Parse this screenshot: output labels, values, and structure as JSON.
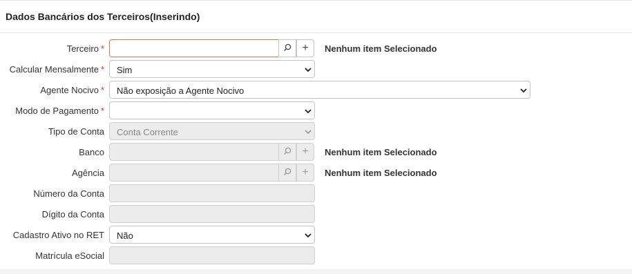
{
  "panel": {
    "title": "Dados Bancários dos Terceiros(Inserindo)"
  },
  "form": {
    "terceiro": {
      "label": "Terceiro",
      "required": "*",
      "value": "",
      "selection": "Nenhum item Selecionado"
    },
    "calcular": {
      "label": "Calcular Mensalmente",
      "required": "*",
      "value": "Sim"
    },
    "agente": {
      "label": "Agente Nocivo",
      "required": "*",
      "value": "Não exposição a Agente Nocivo"
    },
    "modo": {
      "label": "Modo de Pagamento",
      "required": "*",
      "value": ""
    },
    "tipo": {
      "label": "Tipo de Conta",
      "value": "Conta Corrente"
    },
    "banco": {
      "label": "Banco",
      "value": "",
      "selection": "Nenhum item Selecionado"
    },
    "agencia": {
      "label": "Agência",
      "value": "",
      "selection": "Nenhum item Selecionado"
    },
    "numero": {
      "label": "Número da Conta",
      "value": ""
    },
    "digito": {
      "label": "Dígito da Conta",
      "value": ""
    },
    "cadastro": {
      "label": "Cadastro Ativo no RET",
      "value": "Não"
    },
    "matricula": {
      "label": "Matrícula eSocial",
      "value": ""
    }
  },
  "icons": {
    "search": "search-icon",
    "add": "plus-icon",
    "dropdown": "chevron-down-icon"
  },
  "colors": {
    "required": "#dd3333",
    "error_border": "#d9734d",
    "disabled_bg": "#ececec"
  }
}
